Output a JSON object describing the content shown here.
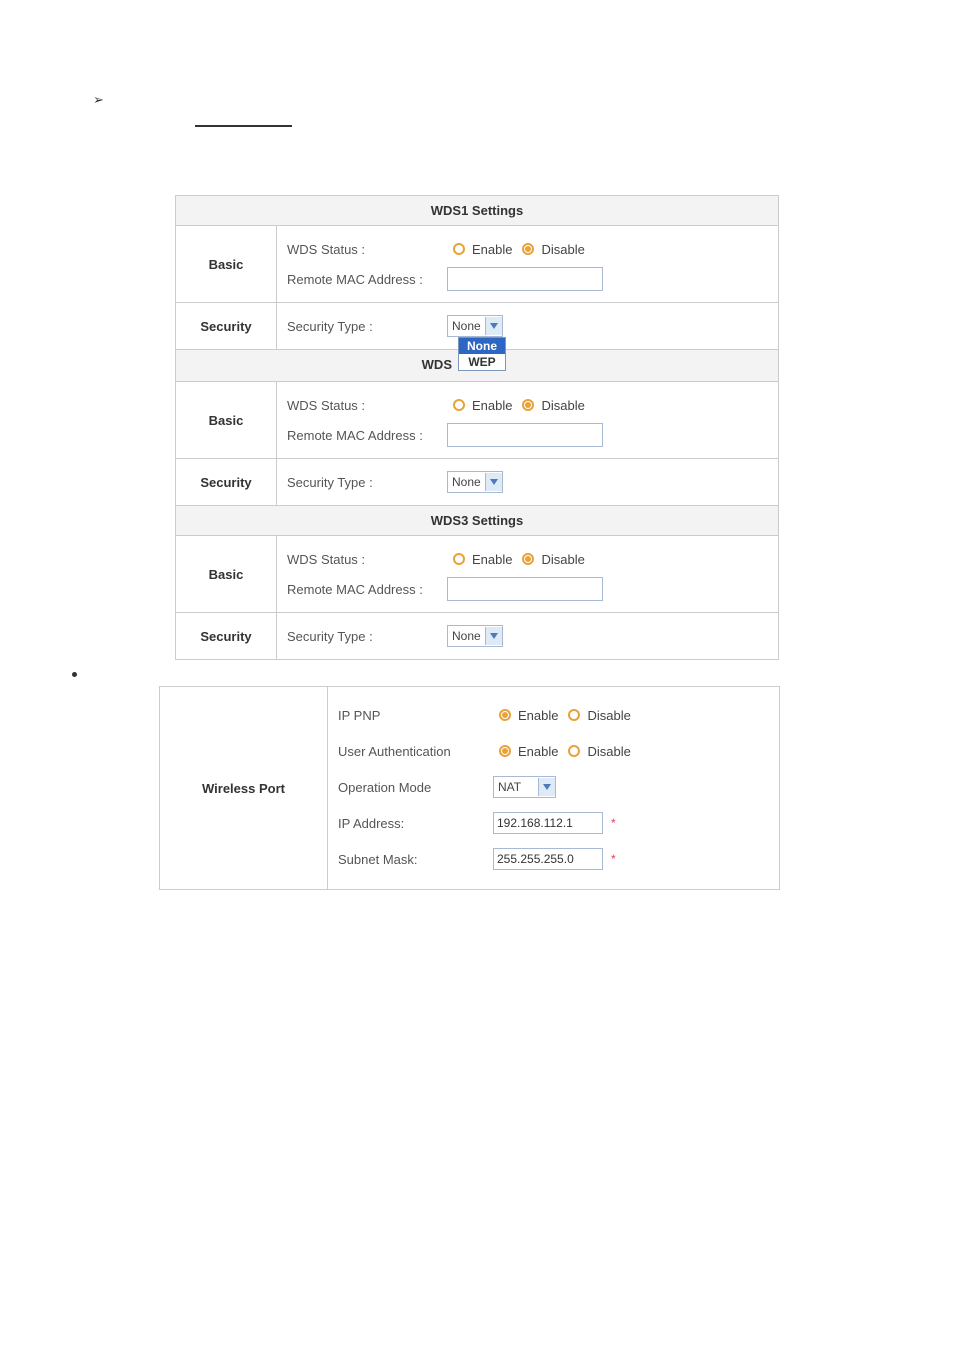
{
  "bullet_arrow_glyph": "➢",
  "wds_table": {
    "blocks": [
      {
        "header": "WDS1 Settings",
        "split_left": "",
        "basic": {
          "cat": "Basic",
          "status_label": "WDS Status :",
          "enable": "Enable",
          "disable": "Disable",
          "selected": "disable",
          "mac_label": "Remote MAC Address :",
          "mac_value": ""
        },
        "security": {
          "cat": "Security",
          "type_label": "Security Type :",
          "type_value": "None"
        },
        "show_dropdown": true
      },
      {
        "header": "",
        "split_left": "WDS",
        "basic": {
          "cat": "Basic",
          "status_label": "WDS Status :",
          "enable": "Enable",
          "disable": "Disable",
          "selected": "disable",
          "mac_label": "Remote MAC Address :",
          "mac_value": ""
        },
        "security": {
          "cat": "Security",
          "type_label": "Security Type :",
          "type_value": "None"
        },
        "show_dropdown": false
      },
      {
        "header": "WDS3 Settings",
        "split_left": "",
        "basic": {
          "cat": "Basic",
          "status_label": "WDS Status :",
          "enable": "Enable",
          "disable": "Disable",
          "selected": "disable",
          "mac_label": "Remote MAC Address :",
          "mac_value": ""
        },
        "security": {
          "cat": "Security",
          "type_label": "Security Type :",
          "type_value": "None"
        },
        "show_dropdown": false
      }
    ],
    "dropdown_options": {
      "opt0": "None",
      "opt1": "WEP"
    }
  },
  "wireless_port": {
    "cat": "Wireless Port",
    "rows": {
      "ippnp": {
        "label": "IP PNP",
        "enable": "Enable",
        "disable": "Disable",
        "selected": "enable"
      },
      "auth": {
        "label": "User Authentication",
        "enable": "Enable",
        "disable": "Disable",
        "selected": "enable"
      },
      "opmode": {
        "label": "Operation Mode",
        "value": "NAT"
      },
      "ip": {
        "label": "IP Address:",
        "value": "192.168.112.1",
        "required": "*"
      },
      "mask": {
        "label": "Subnet Mask:",
        "value": "255.255.255.0",
        "required": "*"
      }
    }
  }
}
